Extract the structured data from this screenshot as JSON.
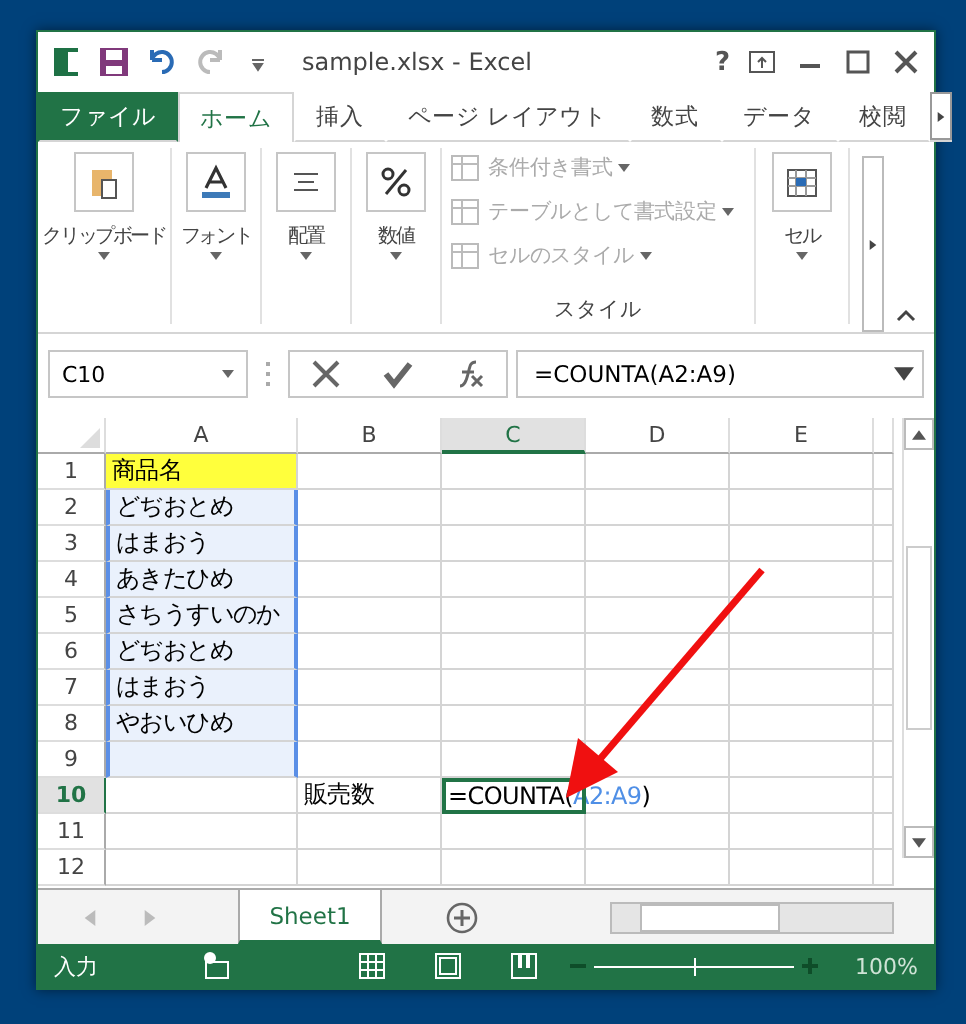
{
  "window": {
    "title": "sample.xlsx - Excel",
    "help": "?"
  },
  "ribbon_tabs": [
    {
      "label": "ファイル",
      "kind": "file",
      "selected": false
    },
    {
      "label": "ホーム",
      "kind": "tab",
      "selected": true
    },
    {
      "label": "挿入",
      "kind": "tab",
      "selected": false
    },
    {
      "label": "ページ レイアウト",
      "kind": "tab",
      "selected": false
    },
    {
      "label": "数式",
      "kind": "tab",
      "selected": false
    },
    {
      "label": "データ",
      "kind": "tab",
      "selected": false
    },
    {
      "label": "校閲",
      "kind": "tab",
      "selected": false
    }
  ],
  "ribbon_groups": [
    {
      "label": "クリップボード",
      "kind": "clipboard"
    },
    {
      "label": "フォント",
      "kind": "font"
    },
    {
      "label": "配置",
      "kind": "align"
    },
    {
      "label": "数値",
      "kind": "number"
    }
  ],
  "styles_group": {
    "label": "スタイル",
    "commands": [
      {
        "label": "条件付き書式",
        "disabled": true
      },
      {
        "label": "テーブルとして書式設定",
        "disabled": true
      },
      {
        "label": "セルのスタイル",
        "disabled": true
      }
    ]
  },
  "cells_group": {
    "label": "セル"
  },
  "name_box": "C10",
  "formula": "=COUNTA(A2:A9)",
  "columns": [
    {
      "label": "A",
      "selected": false
    },
    {
      "label": "B",
      "selected": false
    },
    {
      "label": "C",
      "selected": true
    },
    {
      "label": "D",
      "selected": false
    },
    {
      "label": "E",
      "selected": false
    }
  ],
  "rows": [
    {
      "number": "1",
      "selected": false,
      "a": "商品名",
      "highlighted": true,
      "in_range": false
    },
    {
      "number": "2",
      "selected": false,
      "a": "どぢおとめ",
      "highlighted": false,
      "in_range": true
    },
    {
      "number": "3",
      "selected": false,
      "a": "はまおう",
      "highlighted": false,
      "in_range": true
    },
    {
      "number": "4",
      "selected": false,
      "a": "あきたひめ",
      "highlighted": false,
      "in_range": true
    },
    {
      "number": "5",
      "selected": false,
      "a": "さちうすいのか",
      "highlighted": false,
      "in_range": true
    },
    {
      "number": "6",
      "selected": false,
      "a": "どぢおとめ",
      "highlighted": false,
      "in_range": true
    },
    {
      "number": "7",
      "selected": false,
      "a": "はまおう",
      "highlighted": false,
      "in_range": true
    },
    {
      "number": "8",
      "selected": false,
      "a": "やおいひめ",
      "highlighted": false,
      "in_range": true
    },
    {
      "number": "9",
      "selected": false,
      "highlighted": false,
      "in_range": true
    },
    {
      "number": "10",
      "selected": true,
      "b": "販売数",
      "editing": {
        "prefix": "=COUNTA(",
        "ref": "A2:A9",
        "suffix": ")"
      },
      "highlighted": false,
      "in_range": false
    },
    {
      "number": "11",
      "selected": false,
      "highlighted": false,
      "in_range": false
    },
    {
      "number": "12",
      "selected": false,
      "highlighted": false,
      "in_range": false
    }
  ],
  "sheet_tabs": [
    {
      "label": "Sheet1",
      "selected": true
    }
  ],
  "status_bar": {
    "mode": "入力",
    "zoom": {
      "level": 0.5
    },
    "zoom_text": "100%"
  }
}
